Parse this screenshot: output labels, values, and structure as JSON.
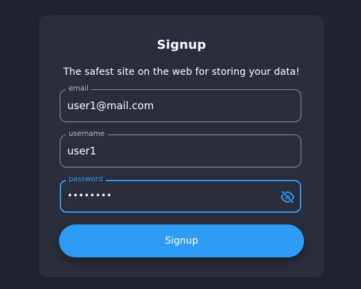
{
  "form": {
    "title": "Signup",
    "subtitle": "The safest site on the web for storing your data!",
    "fields": [
      {
        "label": "email",
        "value": "user1@mail.com"
      },
      {
        "label": "username",
        "value": "user1"
      },
      {
        "label": "password",
        "value": "••••••••",
        "icon": "eye-off-icon"
      }
    ],
    "submit_label": "Signup"
  },
  "colors": {
    "background": "#212433",
    "card": "#2a2d3c",
    "accent": "#2e9bf5",
    "field_border": "#8f92a3"
  }
}
